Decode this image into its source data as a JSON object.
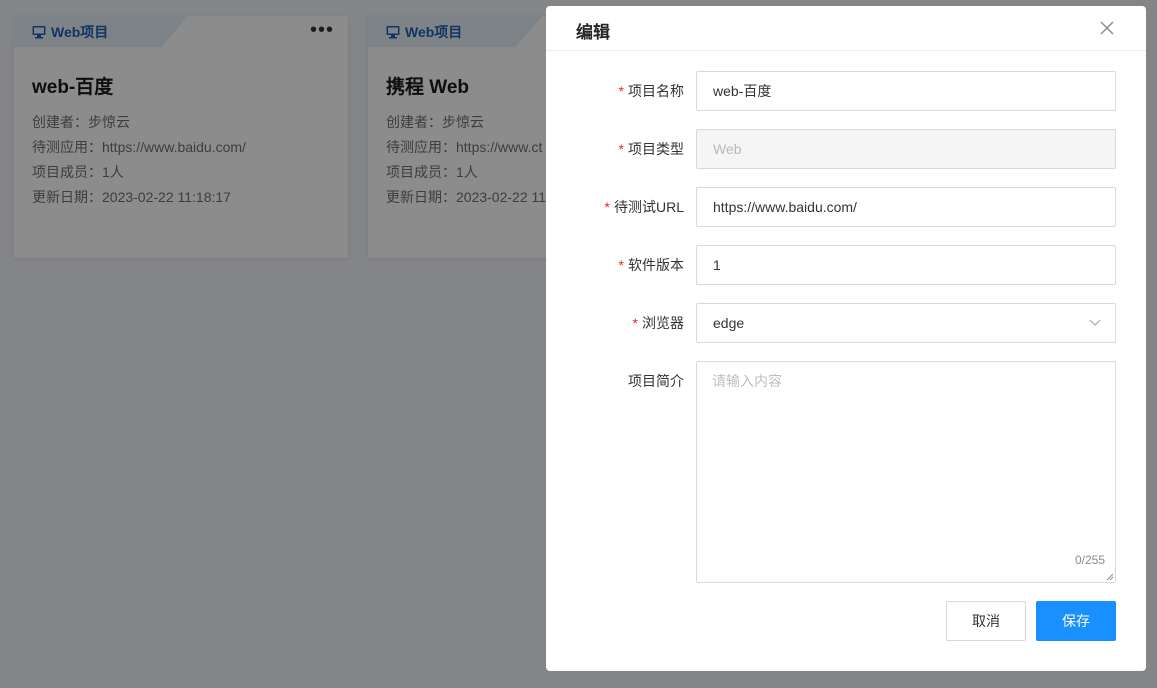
{
  "cards": [
    {
      "tag": "Web项目",
      "more": "•••",
      "title": "web-百度",
      "creator": "创建者：步惊云",
      "app": "待测应用：https://www.baidu.com/",
      "members": "项目成员：1人",
      "updated": "更新日期：2023-02-22 11:18:17"
    },
    {
      "tag": "Web项目",
      "title": "携程 Web",
      "creator": "创建者：步惊云",
      "app": "待测应用：https://www.ct",
      "members": "项目成员：1人",
      "updated": "更新日期：2023-02-22 11"
    }
  ],
  "dialog": {
    "title": "编辑",
    "fields": {
      "name": {
        "label": "项目名称",
        "value": "web-百度",
        "required": "*"
      },
      "type": {
        "label": "项目类型",
        "value": "Web",
        "required": "*"
      },
      "url": {
        "label": "待测试URL",
        "value": "https://www.baidu.com/",
        "required": "*"
      },
      "version": {
        "label": "软件版本",
        "value": "1",
        "required": "*"
      },
      "browser": {
        "label": "浏览器",
        "value": "edge",
        "required": "*"
      },
      "description": {
        "label": "项目简介",
        "placeholder": "请输入内容",
        "counter": "0/255"
      }
    },
    "cancel_label": "取消",
    "save_label": "保存"
  },
  "colors": {
    "primary": "#1890ff",
    "required": "#f5222d",
    "tag_text": "#1f5fb8"
  }
}
